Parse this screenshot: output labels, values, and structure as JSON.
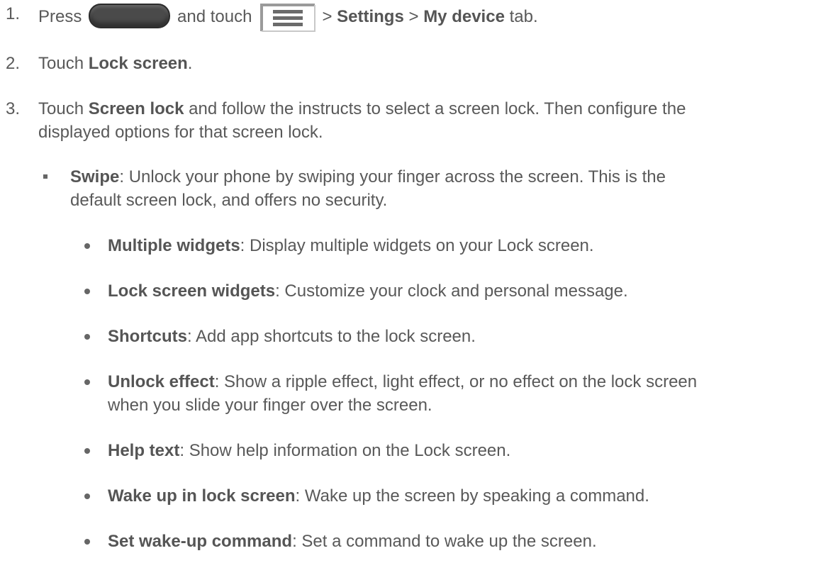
{
  "steps": [
    {
      "number": "1.",
      "press": "Press",
      "and_touch": "and touch",
      "sep1": ">",
      "settings": "Settings",
      "sep2": ">",
      "my_device": "My device",
      "tab": "tab."
    },
    {
      "number": "2.",
      "prefix": "Touch",
      "bold": "Lock screen",
      "suffix": "."
    },
    {
      "number": "3.",
      "prefix": "Touch",
      "bold": "Screen lock",
      "line1_rest": "and follow the instructs to select a screen lock. Then configure the",
      "line2": "displayed options for that screen lock."
    }
  ],
  "swipe": {
    "bold": "Swipe",
    "line1_rest": ": Unlock your phone by swiping your finger across the screen. This is the",
    "line2": "default screen lock, and offers no security."
  },
  "options": [
    {
      "bold": "Multiple widgets",
      "text": ": Display multiple widgets on your Lock screen."
    },
    {
      "bold": "Lock screen widgets",
      "text": ": Customize your clock and personal message."
    },
    {
      "bold": "Shortcuts",
      "text": ": Add app shortcuts to the lock screen."
    },
    {
      "bold": "Unlock effect",
      "text": ": Show a ripple effect, light effect, or no effect on the lock screen",
      "line2": "when you slide your finger over the screen."
    },
    {
      "bold": "Help text",
      "text": ": Show help information on the Lock screen."
    },
    {
      "bold": "Wake up in lock screen",
      "text": ": Wake up the screen by speaking a command."
    },
    {
      "bold": "Set wake-up command",
      "text": ": Set a command to wake up the screen."
    }
  ],
  "icons": {
    "home_key": "home-key-icon",
    "menu_key": "menu-key-icon"
  }
}
